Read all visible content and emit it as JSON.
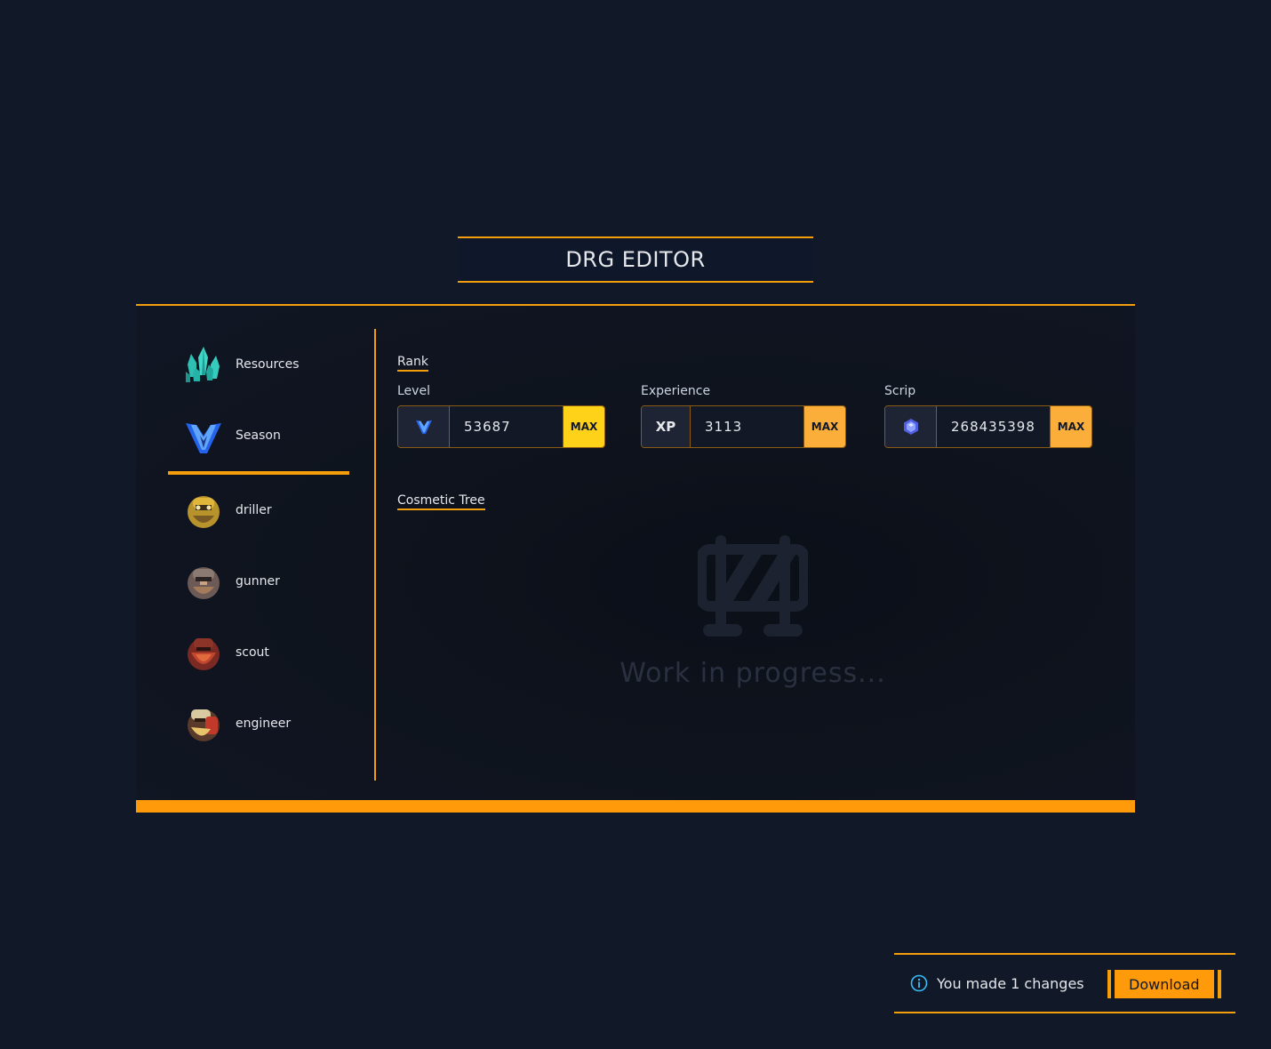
{
  "app": {
    "title": "DRG EDITOR"
  },
  "sidebar": {
    "items": [
      {
        "label": "Resources",
        "icon": "crystal-icon"
      },
      {
        "label": "Season",
        "icon": "season-icon",
        "active": true
      },
      {
        "label": "driller",
        "icon": "driller-portrait"
      },
      {
        "label": "gunner",
        "icon": "gunner-portrait"
      },
      {
        "label": "scout",
        "icon": "scout-portrait"
      },
      {
        "label": "engineer",
        "icon": "engineer-portrait"
      }
    ]
  },
  "rank": {
    "section_title": "Rank",
    "level": {
      "label": "Level",
      "value": "53687",
      "max_label": "MAX",
      "max_color": "#ffd21a",
      "icon": "season-icon"
    },
    "experience": {
      "label": "Experience",
      "prefix": "XP",
      "value": "3113",
      "max_label": "MAX",
      "max_color": "#fcae3a"
    },
    "scrip": {
      "label": "Scrip",
      "value": "268435398",
      "max_label": "MAX",
      "max_color": "#fcae3a",
      "icon": "scrip-gem-icon"
    }
  },
  "cosmetic": {
    "section_title": "Cosmetic Tree",
    "wip_text": "Work in progress...",
    "icon": "barrier-icon"
  },
  "toast": {
    "message": "You made 1 changes",
    "download_label": "Download",
    "icon": "info-icon"
  },
  "colors": {
    "accent": "#f59e0b",
    "background": "#111827",
    "download": "#ff9a0a"
  }
}
